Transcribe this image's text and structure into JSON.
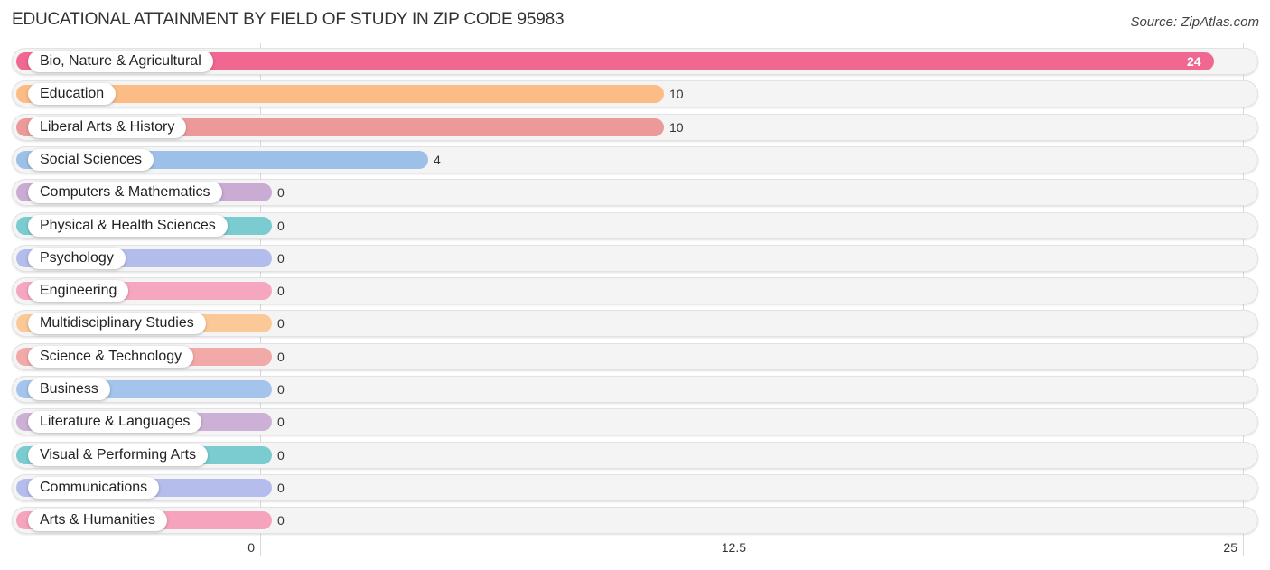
{
  "chart_data": {
    "type": "bar",
    "orientation": "horizontal",
    "title": "EDUCATIONAL ATTAINMENT BY FIELD OF STUDY IN ZIP CODE 95983",
    "source": "Source: ZipAtlas.com",
    "xlabel": "",
    "ylabel": "",
    "xlim": [
      0,
      25
    ],
    "grid": true,
    "x_ticks": [
      "0",
      "12.5",
      "25"
    ],
    "x_tick_values": [
      0,
      12.5,
      25
    ],
    "categories": [
      "Bio, Nature & Agricultural",
      "Education",
      "Liberal Arts & History",
      "Social Sciences",
      "Computers & Mathematics",
      "Physical & Health Sciences",
      "Psychology",
      "Engineering",
      "Multidisciplinary Studies",
      "Science & Technology",
      "Business",
      "Literature & Languages",
      "Visual & Performing Arts",
      "Communications",
      "Arts & Humanities"
    ],
    "values": [
      24,
      10,
      10,
      4,
      0,
      0,
      0,
      0,
      0,
      0,
      0,
      0,
      0,
      0,
      0
    ],
    "value_labels": [
      "24",
      "10",
      "10",
      "4",
      "0",
      "0",
      "0",
      "0",
      "0",
      "0",
      "0",
      "0",
      "0",
      "0",
      "0"
    ],
    "colors": [
      "#f06892",
      "#fbbd85",
      "#ec9a99",
      "#9dc0e8",
      "#c9abd3",
      "#7accd0",
      "#b3bdec",
      "#f6a7c0",
      "#fbc997",
      "#f2aaa8",
      "#a4c4ec",
      "#cdb0d5",
      "#7accd0",
      "#b5bdec",
      "#f6a4bd"
    ]
  }
}
